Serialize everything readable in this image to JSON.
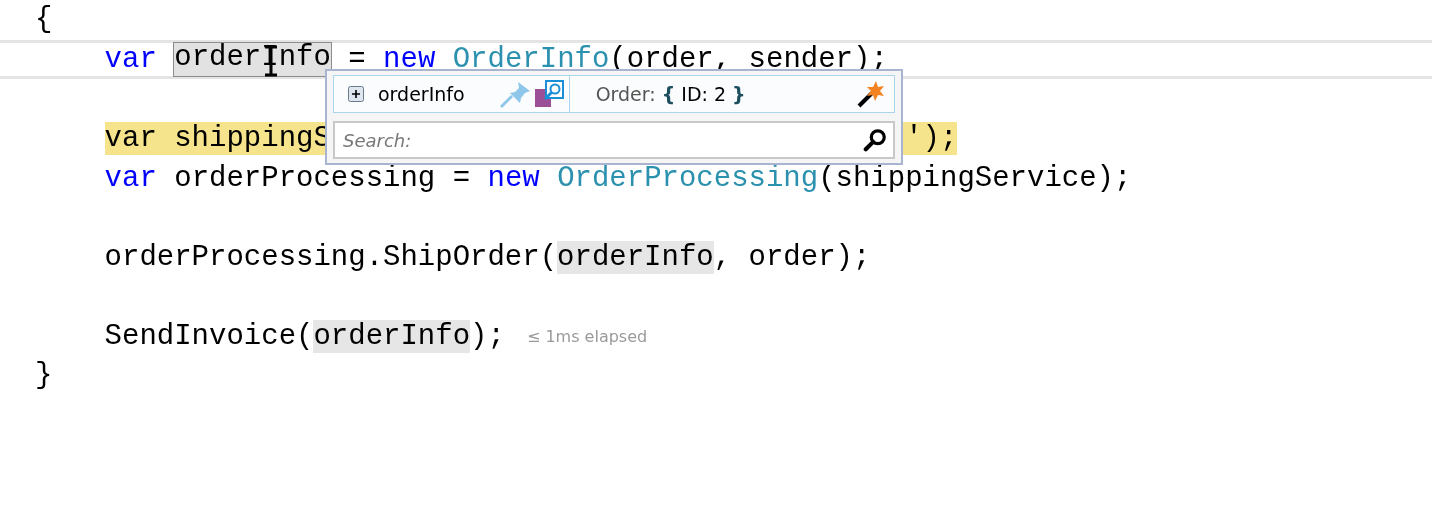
{
  "code": {
    "open_brace": "{",
    "close_brace": "}",
    "lines": [
      {
        "kind": "code",
        "current": true,
        "highlighted": false,
        "tokens": [
          {
            "kind": "keyword",
            "text": "var "
          },
          {
            "kind": "selected",
            "text": "orderInfo"
          },
          {
            "kind": "plain",
            "text": " = "
          },
          {
            "kind": "keyword",
            "text": "new "
          },
          {
            "kind": "type",
            "text": "OrderInfo"
          },
          {
            "kind": "plain",
            "text": "(order, sender);"
          }
        ]
      },
      {
        "kind": "blank"
      },
      {
        "kind": "interrupted",
        "current": false,
        "highlighted": true,
        "tokens": [
          {
            "kind": "plain",
            "text": "var shippingS"
          },
          {
            "kind": "plain",
            "text": "');"
          }
        ]
      },
      {
        "kind": "code",
        "current": false,
        "highlighted": false,
        "tokens": [
          {
            "kind": "keyword",
            "text": "var "
          },
          {
            "kind": "plain",
            "text": "orderProcessing = "
          },
          {
            "kind": "keyword",
            "text": "new "
          },
          {
            "kind": "type",
            "text": "OrderProcessing"
          },
          {
            "kind": "plain",
            "text": "(shippingService);"
          }
        ]
      },
      {
        "kind": "blank"
      },
      {
        "kind": "code",
        "current": false,
        "highlighted": false,
        "tokens": [
          {
            "kind": "plain",
            "text": "orderProcessing.ShipOrder("
          },
          {
            "kind": "reference",
            "text": "orderInfo"
          },
          {
            "kind": "plain",
            "text": ", order);"
          }
        ]
      },
      {
        "kind": "blank"
      },
      {
        "kind": "code",
        "current": false,
        "highlighted": false,
        "tokens": [
          {
            "kind": "plain",
            "text": "SendInvoice("
          },
          {
            "kind": "reference",
            "text": "orderInfo"
          },
          {
            "kind": "plain",
            "text": ");"
          }
        ],
        "note": "≤ 1ms elapsed"
      }
    ]
  },
  "datatip": {
    "name": "orderInfo",
    "expanded": false,
    "type_label": "Order:",
    "open_brace": "{",
    "value": "ID: 2",
    "close_brace": "}",
    "search": {
      "placeholder": "Search:"
    }
  }
}
